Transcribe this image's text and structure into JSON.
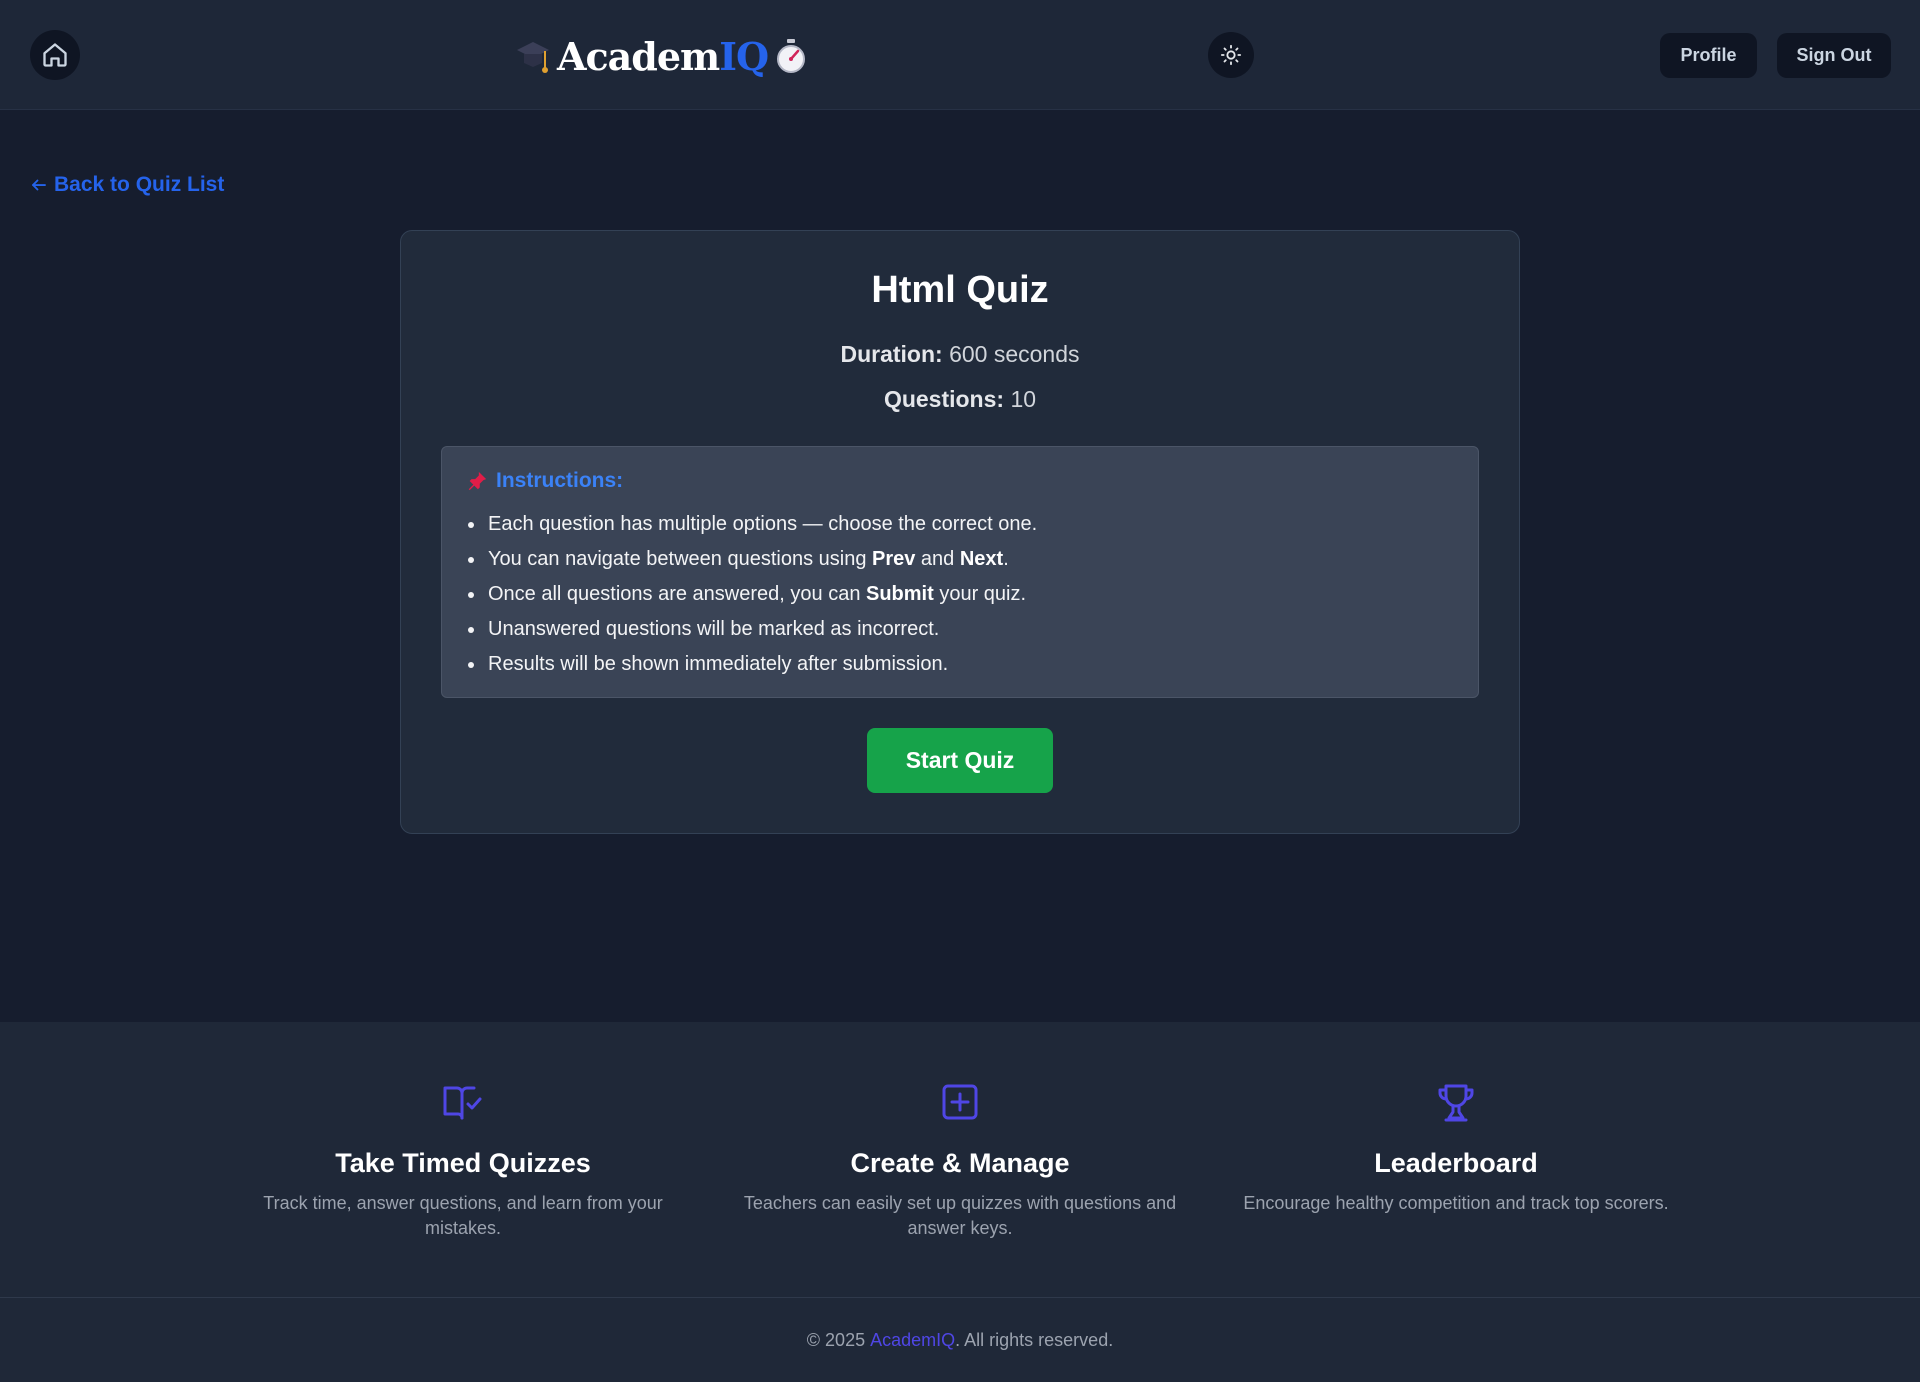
{
  "header": {
    "logo_part1": "Academ",
    "logo_part2": "IQ",
    "profile_label": "Profile",
    "signout_label": "Sign Out"
  },
  "back_link": {
    "label": "Back to Quiz List"
  },
  "quiz": {
    "title": "Html Quiz",
    "duration_label": "Duration:",
    "duration_value": "600 seconds",
    "questions_label": "Questions:",
    "questions_value": "10",
    "instructions_title": "Instructions:",
    "instructions": [
      {
        "pre": "Each question has multiple options — choose the correct one.",
        "b1": "",
        "mid": "",
        "b2": "",
        "post": ""
      },
      {
        "pre": "You can navigate between questions using ",
        "b1": "Prev",
        "mid": " and ",
        "b2": "Next",
        "post": "."
      },
      {
        "pre": "Once all questions are answered, you can ",
        "b1": "Submit",
        "mid": " your quiz.",
        "b2": "",
        "post": ""
      },
      {
        "pre": "Unanswered questions will be marked as incorrect.",
        "b1": "",
        "mid": "",
        "b2": "",
        "post": ""
      },
      {
        "pre": "Results will be shown immediately after submission.",
        "b1": "",
        "mid": "",
        "b2": "",
        "post": ""
      }
    ],
    "start_label": "Start Quiz"
  },
  "features": [
    {
      "icon": "book-check-icon",
      "title": "Take Timed Quizzes",
      "desc": "Track time, answer questions, and learn from your mistakes."
    },
    {
      "icon": "plus-square-icon",
      "title": "Create & Manage",
      "desc": "Teachers can easily set up quizzes with questions and answer keys."
    },
    {
      "icon": "trophy-icon",
      "title": "Leaderboard",
      "desc": "Encourage healthy competition and track top scorers."
    }
  ],
  "footer": {
    "prefix": "© 2025 ",
    "brand": "AcademIQ",
    "suffix": ". All rights reserved."
  },
  "colors": {
    "accent": "#2563eb",
    "start_button": "#16a34a",
    "feature_icon": "#4f46e5",
    "background": "#161d2e"
  }
}
